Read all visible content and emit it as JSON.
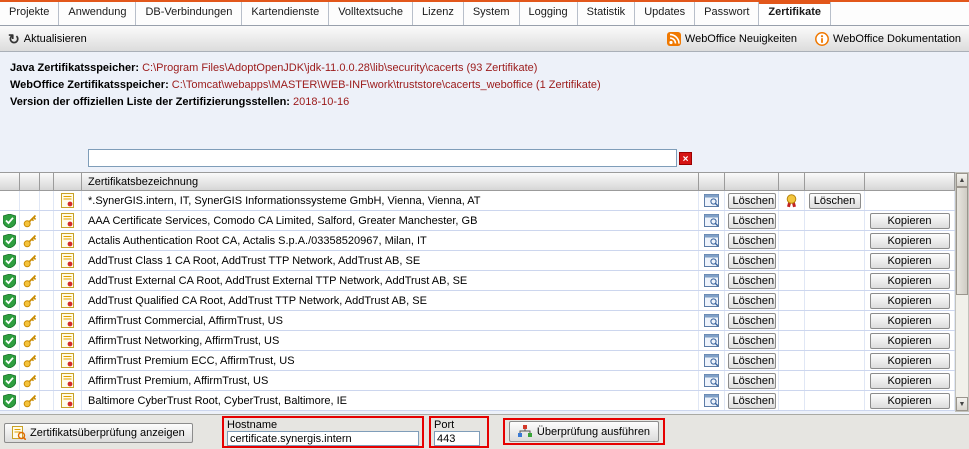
{
  "tabs": [
    {
      "label": "Projekte"
    },
    {
      "label": "Anwendung"
    },
    {
      "label": "DB-Verbindungen"
    },
    {
      "label": "Kartendienste"
    },
    {
      "label": "Volltextsuche"
    },
    {
      "label": "Lizenz"
    },
    {
      "label": "System"
    },
    {
      "label": "Logging"
    },
    {
      "label": "Statistik"
    },
    {
      "label": "Updates"
    },
    {
      "label": "Passwort"
    },
    {
      "label": "Zertifikate",
      "active": true
    }
  ],
  "toolbar": {
    "refresh_label": "Aktualisieren",
    "news_label": "WebOffice Neuigkeiten",
    "doc_label": "WebOffice Dokumentation"
  },
  "info": {
    "lines": [
      {
        "label": "Java Zertifikatsspeicher:",
        "value": "C:\\Program Files\\AdoptOpenJDK\\jdk-11.0.0.28\\lib\\security\\cacerts (93 Zertifikate)"
      },
      {
        "label": "WebOffice Zertifikatsspeicher:",
        "value": "C:\\Tomcat\\webapps\\MASTER\\WEB-INF\\work\\truststore\\cacerts_weboffice (1 Zertifikate)"
      },
      {
        "label": "Version der offiziellen Liste der Zertifizierungsstellen:",
        "value": "2018-10-16"
      }
    ]
  },
  "search": {
    "value": ""
  },
  "table": {
    "header": "Zertifikatsbezeichnung",
    "delete_label": "Löschen",
    "copy_label": "Kopieren",
    "rows": [
      {
        "type": "weboffice",
        "name": "*.SynerGIS.intern, IT, SynerGIS Informationssysteme GmbH, Vienna, Vienna, AT"
      },
      {
        "type": "ca",
        "name": "AAA Certificate Services, Comodo CA Limited, Salford, Greater Manchester, GB"
      },
      {
        "type": "ca",
        "name": "Actalis Authentication Root CA, Actalis S.p.A./03358520967, Milan, IT"
      },
      {
        "type": "ca",
        "name": "AddTrust Class 1 CA Root, AddTrust TTP Network, AddTrust AB, SE"
      },
      {
        "type": "ca",
        "name": "AddTrust External CA Root, AddTrust External TTP Network, AddTrust AB, SE"
      },
      {
        "type": "ca",
        "name": "AddTrust Qualified CA Root, AddTrust TTP Network, AddTrust AB, SE"
      },
      {
        "type": "ca",
        "name": "AffirmTrust Commercial, AffirmTrust, US"
      },
      {
        "type": "ca",
        "name": "AffirmTrust Networking, AffirmTrust, US"
      },
      {
        "type": "ca",
        "name": "AffirmTrust Premium ECC, AffirmTrust, US"
      },
      {
        "type": "ca",
        "name": "AffirmTrust Premium, AffirmTrust, US"
      },
      {
        "type": "ca",
        "name": "Baltimore CyberTrust Root, CyberTrust, Baltimore, IE"
      }
    ]
  },
  "footer": {
    "show_check_label": "Zertifikatsüberprüfung anzeigen",
    "hostname_label": "Hostname",
    "hostname_value": "certificate.synergis.intern",
    "port_label": "Port",
    "port_value": "443",
    "run_check_label": "Überprüfung ausführen"
  },
  "icons": {
    "refresh": "↻",
    "clear": "×",
    "scroll_up": "▲",
    "scroll_down": "▼"
  },
  "colors": {
    "accent_orange": "#e2571b",
    "annotation_red": "#e60000",
    "value_red": "#9b1a1a",
    "shield_green": "#2e9e3f",
    "key_gold": "#f5c33b"
  }
}
